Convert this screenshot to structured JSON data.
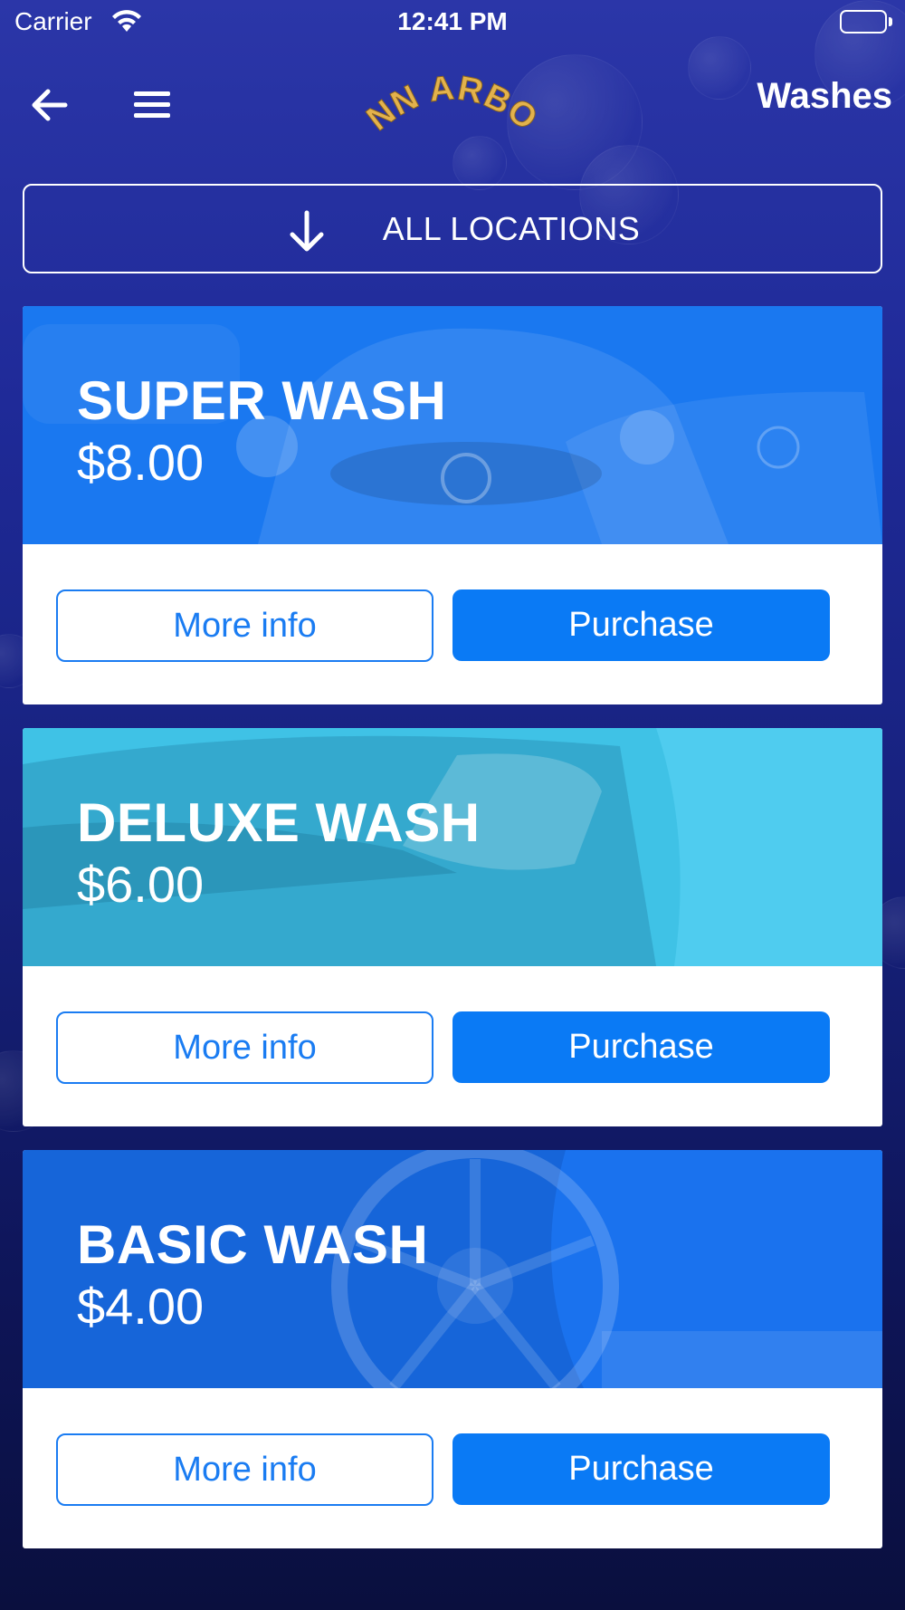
{
  "status_bar": {
    "carrier": "Carrier",
    "time": "12:41 PM"
  },
  "nav": {
    "back_icon": "arrow-left-icon",
    "menu_icon": "hamburger-menu-icon",
    "logo_text": "ANN ARBOR",
    "title": "Washes"
  },
  "location_selector": {
    "icon": "arrow-down-icon",
    "label": "ALL LOCATIONS"
  },
  "colors": {
    "background_top": "#2b36a8",
    "background_bottom": "#0a0f3e",
    "logo_gold": "#e3b24c",
    "button_blue": "#0a7af5",
    "button_outline": "#1a7cf2"
  },
  "washes": [
    {
      "name": "SUPER WASH",
      "price": "$8.00",
      "more_info_label": "More info",
      "purchase_label": "Purchase",
      "banner_color": "#1a78f0"
    },
    {
      "name": "DELUXE WASH",
      "price": "$6.00",
      "more_info_label": "More info",
      "purchase_label": "Purchase",
      "banner_color": "#3fc2e6"
    },
    {
      "name": "BASIC WASH",
      "price": "$4.00",
      "more_info_label": "More info",
      "purchase_label": "Purchase",
      "banner_color": "#1a72ee"
    }
  ]
}
